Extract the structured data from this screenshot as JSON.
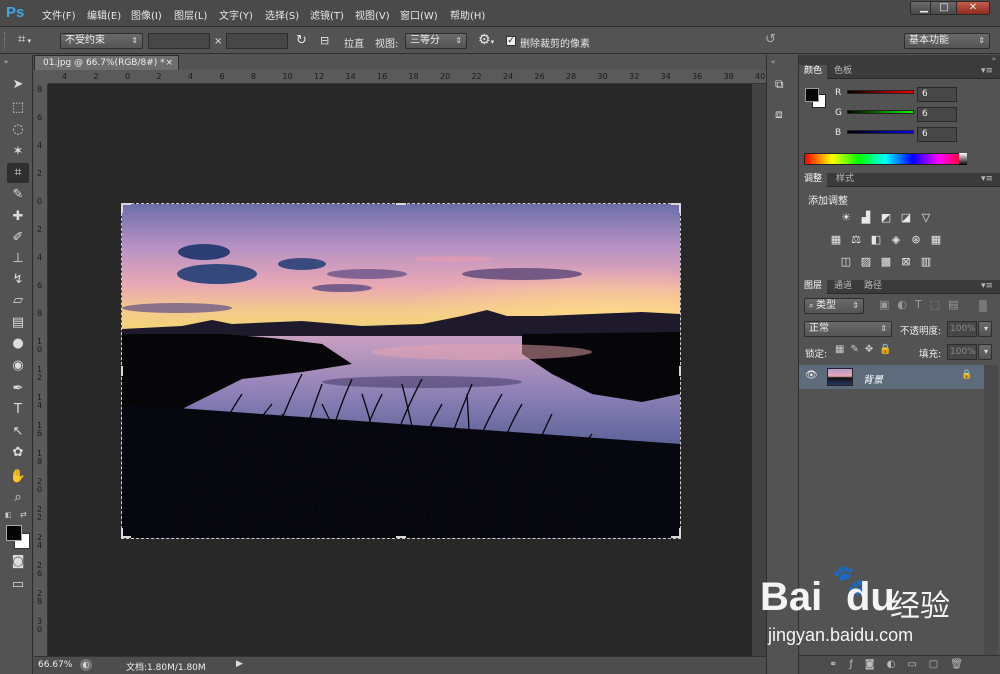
{
  "app": {
    "logo": "Ps"
  },
  "menu": [
    "文件(F)",
    "编辑(E)",
    "图像(I)",
    "图层(L)",
    "文字(Y)",
    "选择(S)",
    "滤镜(T)",
    "视图(V)",
    "窗口(W)",
    "帮助(H)"
  ],
  "window_controls": {
    "minimize": "▁",
    "maximize": "□",
    "close": "✕"
  },
  "options": {
    "ratio": "不受约束",
    "times": "×",
    "straighten": "拉直",
    "view_label": "视图:",
    "view_value": "三等分",
    "delete_cropped": "删除裁剪的像素",
    "delete_checked": true,
    "workspace": "基本功能"
  },
  "document": {
    "tab_title": "01.jpg @ 66.7%(RGB/8#) *",
    "close": "×",
    "zoom": "66.67%",
    "doc_info": "文档:1.80M/1.80M",
    "ruler_top": [
      "4",
      "2",
      "0",
      "2",
      "4",
      "6",
      "8",
      "10",
      "12",
      "14",
      "16",
      "18",
      "20",
      "22",
      "24",
      "26",
      "28",
      "30",
      "32",
      "34",
      "36",
      "38",
      "40"
    ],
    "ruler_left": [
      "8",
      "6",
      "4",
      "2",
      "0",
      "2",
      "4",
      "6",
      "8",
      "10",
      "12",
      "14",
      "16",
      "18",
      "20",
      "22",
      "24",
      "26",
      "28",
      "30"
    ]
  },
  "panels": {
    "color": {
      "tabs": [
        "颜色",
        "色板"
      ],
      "r": "6",
      "g": "6",
      "b": "6",
      "r_label": "R",
      "g_label": "G",
      "b_label": "B"
    },
    "adjust": {
      "tabs": [
        "调整",
        "样式"
      ],
      "title": "添加调整"
    },
    "layers": {
      "tabs": [
        "图层",
        "通道",
        "路径"
      ],
      "filter": "类型",
      "blend": "正常",
      "opacity_label": "不透明度:",
      "opacity": "100%",
      "lock_label": "锁定:",
      "fill_label": "填充:",
      "fill": "100%",
      "layer_name": "背景"
    }
  },
  "watermark": {
    "brand": "Bai",
    "brand2": "du",
    "cn": "经验",
    "url": "jingyan.baidu.com"
  },
  "colors": {
    "accent": "#3fa6e6",
    "bg_dark": "#282828",
    "panel": "#535353"
  }
}
